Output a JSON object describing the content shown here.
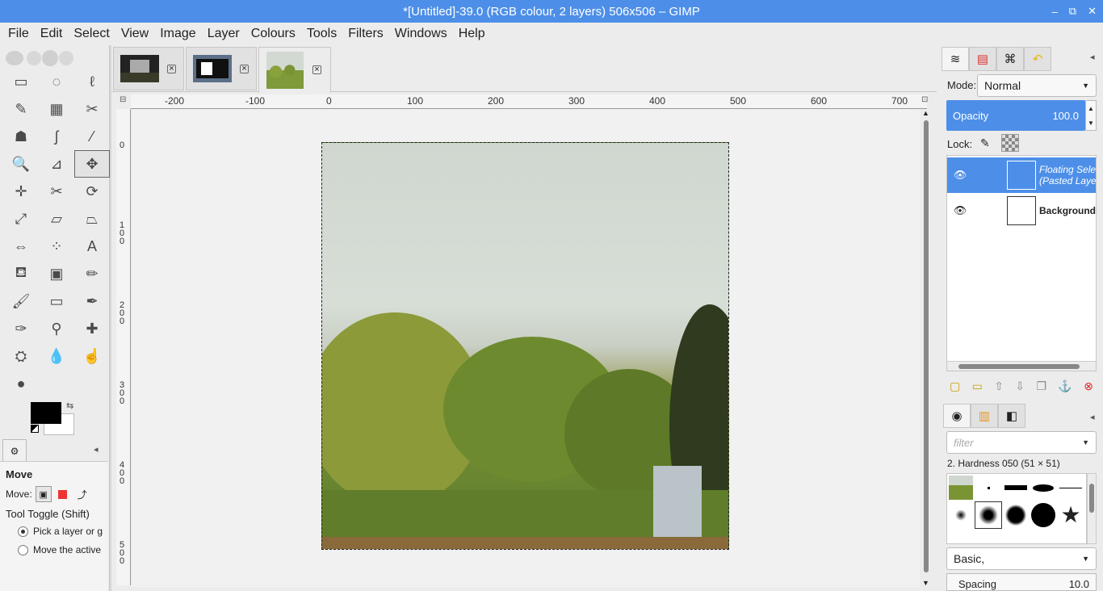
{
  "window": {
    "title": "*[Untitled]-39.0 (RGB colour, 2 layers) 506x506 – GIMP",
    "controls": [
      "–",
      "⧉",
      "✕"
    ]
  },
  "menu": [
    "File",
    "Edit",
    "Select",
    "View",
    "Image",
    "Layer",
    "Colours",
    "Tools",
    "Filters",
    "Windows",
    "Help"
  ],
  "toolbox": {
    "tools": [
      {
        "name": "rect-select-icon",
        "glyph": "▭"
      },
      {
        "name": "ellipse-select-icon",
        "glyph": "◌"
      },
      {
        "name": "free-select-icon",
        "glyph": "ℓ"
      },
      {
        "name": "fuzzy-select-icon",
        "glyph": "✎"
      },
      {
        "name": "color-select-icon",
        "glyph": "▦"
      },
      {
        "name": "scissors-icon",
        "glyph": "✂"
      },
      {
        "name": "foreground-select-icon",
        "glyph": "☗"
      },
      {
        "name": "paths-icon",
        "glyph": "ʃ"
      },
      {
        "name": "color-picker-icon",
        "glyph": "⁄"
      },
      {
        "name": "zoom-icon",
        "glyph": "🔍"
      },
      {
        "name": "measure-icon",
        "glyph": "⊿"
      },
      {
        "name": "move-icon",
        "glyph": "✥",
        "active": true
      },
      {
        "name": "align-icon",
        "glyph": "✛"
      },
      {
        "name": "crop-icon",
        "glyph": "✂"
      },
      {
        "name": "rotate-icon",
        "glyph": "⟳"
      },
      {
        "name": "scale-icon",
        "glyph": "⤢"
      },
      {
        "name": "shear-icon",
        "glyph": "▱"
      },
      {
        "name": "perspective-icon",
        "glyph": "⏢"
      },
      {
        "name": "flip-icon",
        "glyph": "⇔"
      },
      {
        "name": "cage-icon",
        "glyph": "⁘"
      },
      {
        "name": "text-icon",
        "glyph": "A"
      },
      {
        "name": "bucket-fill-icon",
        "glyph": "⛾"
      },
      {
        "name": "blend-icon",
        "glyph": "▣"
      },
      {
        "name": "pencil-icon",
        "glyph": "✏"
      },
      {
        "name": "paintbrush-icon",
        "glyph": "🖌"
      },
      {
        "name": "eraser-icon",
        "glyph": "▭"
      },
      {
        "name": "airbrush-icon",
        "glyph": "✒"
      },
      {
        "name": "ink-icon",
        "glyph": "✑"
      },
      {
        "name": "clone-icon",
        "glyph": "⚲"
      },
      {
        "name": "heal-icon",
        "glyph": "✚"
      },
      {
        "name": "perspective-clone-icon",
        "glyph": "⛭"
      },
      {
        "name": "blur-icon",
        "glyph": "💧"
      },
      {
        "name": "smudge-icon",
        "glyph": "☝"
      },
      {
        "name": "dodge-burn-icon",
        "glyph": "●"
      }
    ],
    "colors": {
      "foreground": "#000000",
      "background": "#ffffff"
    }
  },
  "tool_options": {
    "title": "Move",
    "move_label": "Move:",
    "toggle_label": "Tool Toggle  (Shift)",
    "radio1": "Pick a layer or g",
    "radio2": "Move the active"
  },
  "image_tabs": [
    {
      "name": "image-tab-1"
    },
    {
      "name": "image-tab-2"
    },
    {
      "name": "image-tab-3",
      "active": true
    }
  ],
  "ruler": {
    "h_labels": [
      "-200",
      "-100",
      "0",
      "100",
      "200",
      "300",
      "400",
      "500",
      "600",
      "700"
    ],
    "v_labels": [
      [
        "0"
      ],
      [
        "1",
        "0",
        "0"
      ],
      [
        "2",
        "0",
        "0"
      ],
      [
        "3",
        "0",
        "0"
      ],
      [
        "4",
        "0",
        "0"
      ],
      [
        "5",
        "0",
        "0"
      ]
    ]
  },
  "layers_dock": {
    "mode_label": "Mode:",
    "mode_value": "Normal",
    "opacity_label": "Opacity",
    "opacity_value": "100.0",
    "lock_label": "Lock:",
    "layers": [
      {
        "name_line1": "Floating Sele",
        "name_line2": "(Pasted Laye",
        "selected": true
      },
      {
        "name_line1": "Background",
        "name_line2": "",
        "selected": false
      }
    ]
  },
  "brushes_dock": {
    "filter_placeholder": "filter",
    "brush_name": "2. Hardness 050 (51 × 51)",
    "preset": "Basic,",
    "spacing_label": "Spacing",
    "spacing_value": "10.0"
  },
  "accent": "#4d8fe8"
}
